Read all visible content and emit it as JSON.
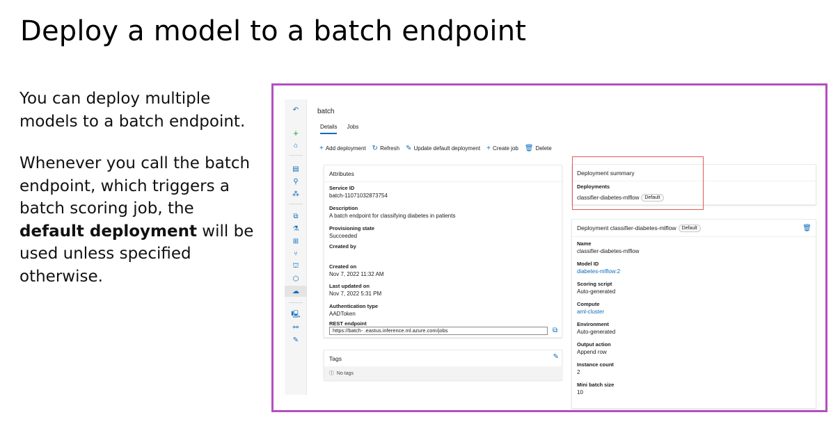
{
  "slide": {
    "title": "Deploy a model to a batch endpoint",
    "para1": "You can deploy multiple models to a batch endpoint.",
    "para2_pre": "Whenever you call the batch endpoint, which triggers a batch scoring job, the ",
    "para2_bold": "default deployment",
    "para2_post": " will be used unless specified otherwise."
  },
  "endpoint": {
    "name": "batch",
    "tabs": [
      "Details",
      "Jobs"
    ],
    "toolbar": {
      "add": "Add deployment",
      "refresh": "Refresh",
      "update": "Update default deployment",
      "create_job": "Create job",
      "delete": "Delete"
    }
  },
  "attributes": {
    "title": "Attributes",
    "service_id_label": "Service ID",
    "service_id": "batch-11071032873754",
    "description_label": "Description",
    "description": "A batch endpoint for classifying diabetes in patients",
    "prov_label": "Provisioning state",
    "prov": "Succeeded",
    "created_by_label": "Created by",
    "created_on_label": "Created on",
    "created_on": "Nov 7, 2022 11:32 AM",
    "updated_label": "Last updated on",
    "updated": "Nov 7, 2022 5:31 PM",
    "auth_label": "Authentication type",
    "auth": "AADToken",
    "rest_label": "REST endpoint",
    "rest_value": "https://batch-                        .eastus.inference.ml.azure.com/jobs"
  },
  "tags": {
    "title": "Tags",
    "empty": "No tags"
  },
  "summary": {
    "title": "Deployment summary",
    "deployments_label": "Deployments",
    "deployment": "classifier-diabetes-mlflow",
    "default_badge": "Default"
  },
  "deployment": {
    "title": "Deployment classifier-diabetes-mlflow",
    "default_badge": "Default",
    "name_label": "Name",
    "name": "classifier-diabetes-mlflow",
    "model_label": "Model ID",
    "model": "diabetes-mlflow:2",
    "scoring_label": "Scoring script",
    "scoring": "Auto-generated",
    "compute_label": "Compute",
    "compute": "aml-cluster",
    "env_label": "Environment",
    "env": "Auto-generated",
    "output_label": "Output action",
    "output": "Append row",
    "instance_label": "Instance count",
    "instance": "2",
    "batch_label": "Mini batch size",
    "batch": "10"
  },
  "colors": {
    "frame": "#b44fbf",
    "highlight": "#e05a5a",
    "accent": "#0f6cbd"
  }
}
